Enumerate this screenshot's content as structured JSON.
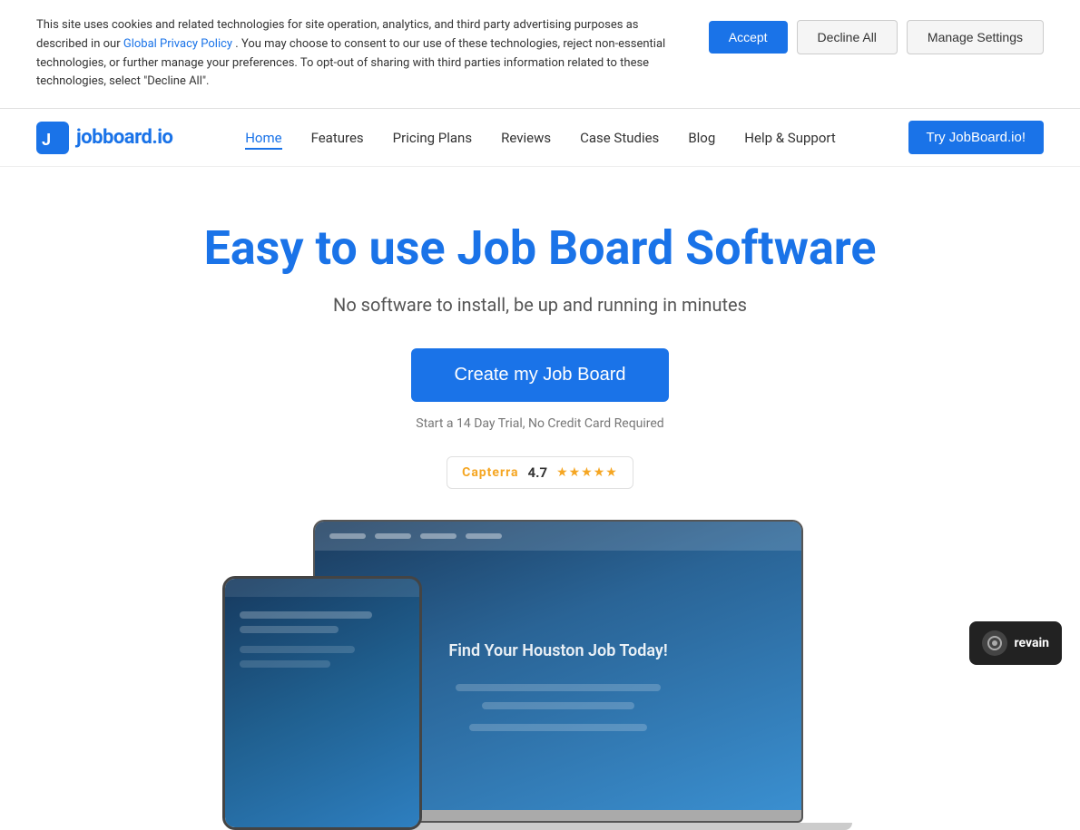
{
  "cookie": {
    "text_part1": "This site uses cookies and related technologies for site operation, analytics, and third party advertising purposes as described in our",
    "privacy_link_text": "Global Privacy Policy",
    "text_part2": ". You may choose to consent to our use of these technologies, reject non-essential technologies, or further manage your preferences. To opt-out of sharing with third parties information related to these technologies, select \"Decline All\".",
    "accept_label": "Accept",
    "decline_label": "Decline All",
    "manage_label": "Manage Settings"
  },
  "nav": {
    "logo_text": "jobboard.io",
    "links": [
      {
        "label": "Home",
        "active": true
      },
      {
        "label": "Features",
        "active": false
      },
      {
        "label": "Pricing Plans",
        "active": false
      },
      {
        "label": "Reviews",
        "active": false
      },
      {
        "label": "Case Studies",
        "active": false
      },
      {
        "label": "Blog",
        "active": false
      },
      {
        "label": "Help & Support",
        "active": false
      }
    ],
    "cta_label": "Try JobBoard.io!"
  },
  "hero": {
    "title": "Easy to use Job Board Software",
    "subtitle": "No software to install, be up and running in minutes",
    "cta_label": "Create my Job Board",
    "note": "Start a 14 Day Trial, No Credit Card Required",
    "capterra": {
      "logo": "Capterra",
      "rating": "4.7",
      "stars": "★★★★★"
    }
  },
  "device_screen": {
    "text": "Find Your Houston Job Today!"
  },
  "revain": {
    "label": "revain"
  }
}
